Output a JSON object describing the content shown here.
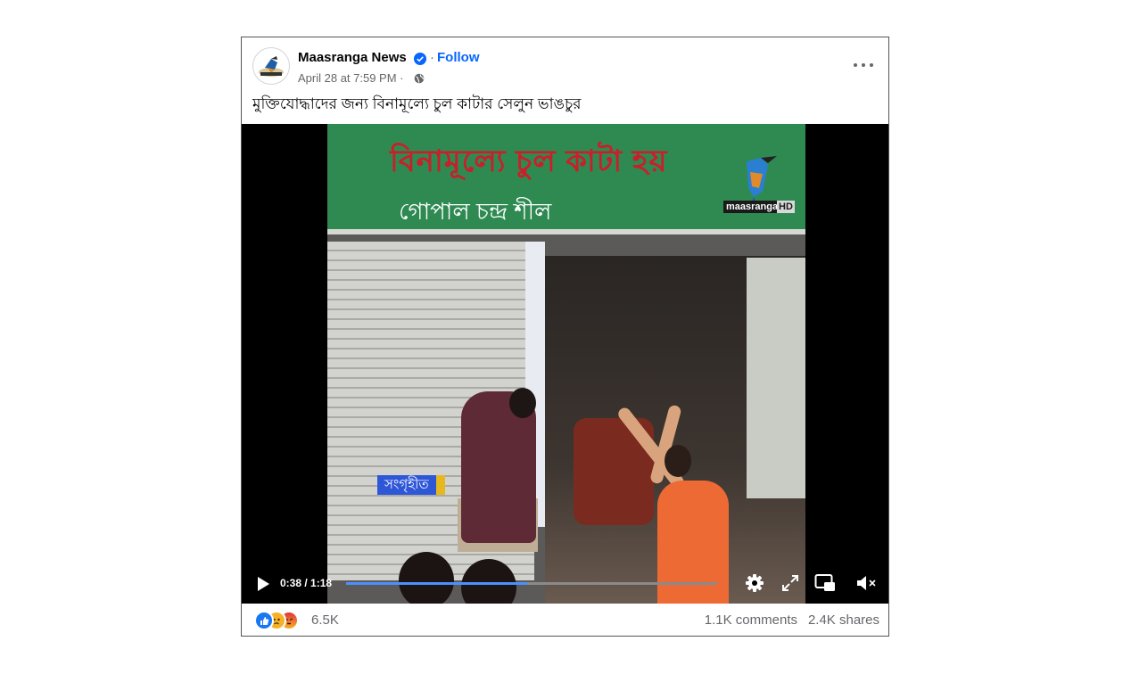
{
  "post": {
    "page_name": "Maasranga News",
    "follow_label": "Follow",
    "separator": "·",
    "timestamp": "April 28 at 7:59 PM ·",
    "caption": "মুক্তিযোদ্ধাদের জন্য বিনামূল্যে চুল কাটার সেলুন ভাঙচুর"
  },
  "video": {
    "sign_line1": "বিনামূল্যে চুল কাটা হয়",
    "sign_line2": "গোপাল চন্দ্র শীল",
    "watermark_text": "maasranga",
    "watermark_hd": "HD",
    "stamp_label": "সংগৃহীত",
    "time_display": "0:38 / 1:18",
    "progress": 0.487
  },
  "engagement": {
    "reaction_count": "6.5K",
    "comments": "1.1K comments",
    "shares": "2.4K shares"
  },
  "colors": {
    "follow": "#0866ff",
    "verified": "#0866ff",
    "progress": "#4a90ff",
    "like": "#1877f2",
    "sad": "#f7b125",
    "angry": "#e9710f"
  },
  "icons": [
    "verified-badge-icon",
    "globe-icon",
    "more-options-icon",
    "play-icon",
    "gear-icon",
    "expand-icon",
    "pip-icon",
    "mute-icon",
    "like-reaction-icon",
    "sad-reaction-icon",
    "angry-reaction-icon"
  ]
}
